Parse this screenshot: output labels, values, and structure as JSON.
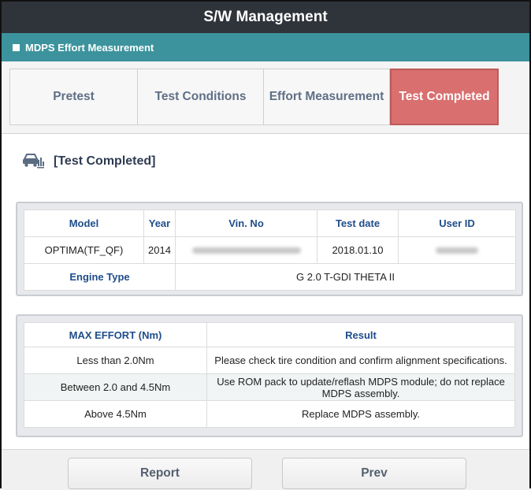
{
  "window": {
    "title": "S/W Management"
  },
  "section": {
    "title": "MDPS Effort Measurement"
  },
  "tabs": [
    {
      "label": "Pretest",
      "active": false
    },
    {
      "label": "Test Conditions",
      "active": false
    },
    {
      "label": "Effort Measurement",
      "active": false
    },
    {
      "label": "Test Completed",
      "active": true
    }
  ],
  "heading": {
    "label": "[Test Completed]",
    "icon": "car-chart-icon"
  },
  "vehicle_table": {
    "headers": {
      "model": "Model",
      "year": "Year",
      "vin": "Vin. No",
      "test_date": "Test date",
      "user_id": "User ID"
    },
    "row": {
      "model": "OPTIMA(TF_QF)",
      "year": "2014",
      "test_date": "2018.01.10"
    },
    "engine_label": "Engine Type",
    "engine_value": "G 2.0 T-GDI THETA II"
  },
  "result_table": {
    "headers": {
      "effort": "MAX EFFORT (Nm)",
      "result": "Result"
    },
    "rows": [
      {
        "effort": "Less than 2.0Nm",
        "result": "Please check tire condition and confirm alignment specifications."
      },
      {
        "effort": "Between 2.0 and 4.5Nm",
        "result": "Use ROM pack to update/reflash MDPS module; do not replace MDPS assembly."
      },
      {
        "effort": "Above 4.5Nm",
        "result": "Replace MDPS assembly."
      }
    ]
  },
  "footer": {
    "report_label": "Report",
    "prev_label": "Prev"
  },
  "colors": {
    "titlebar": "#2f333a",
    "section": "#3c939d",
    "active_tab": "#d96f6f",
    "header_text": "#1f4d8a"
  }
}
